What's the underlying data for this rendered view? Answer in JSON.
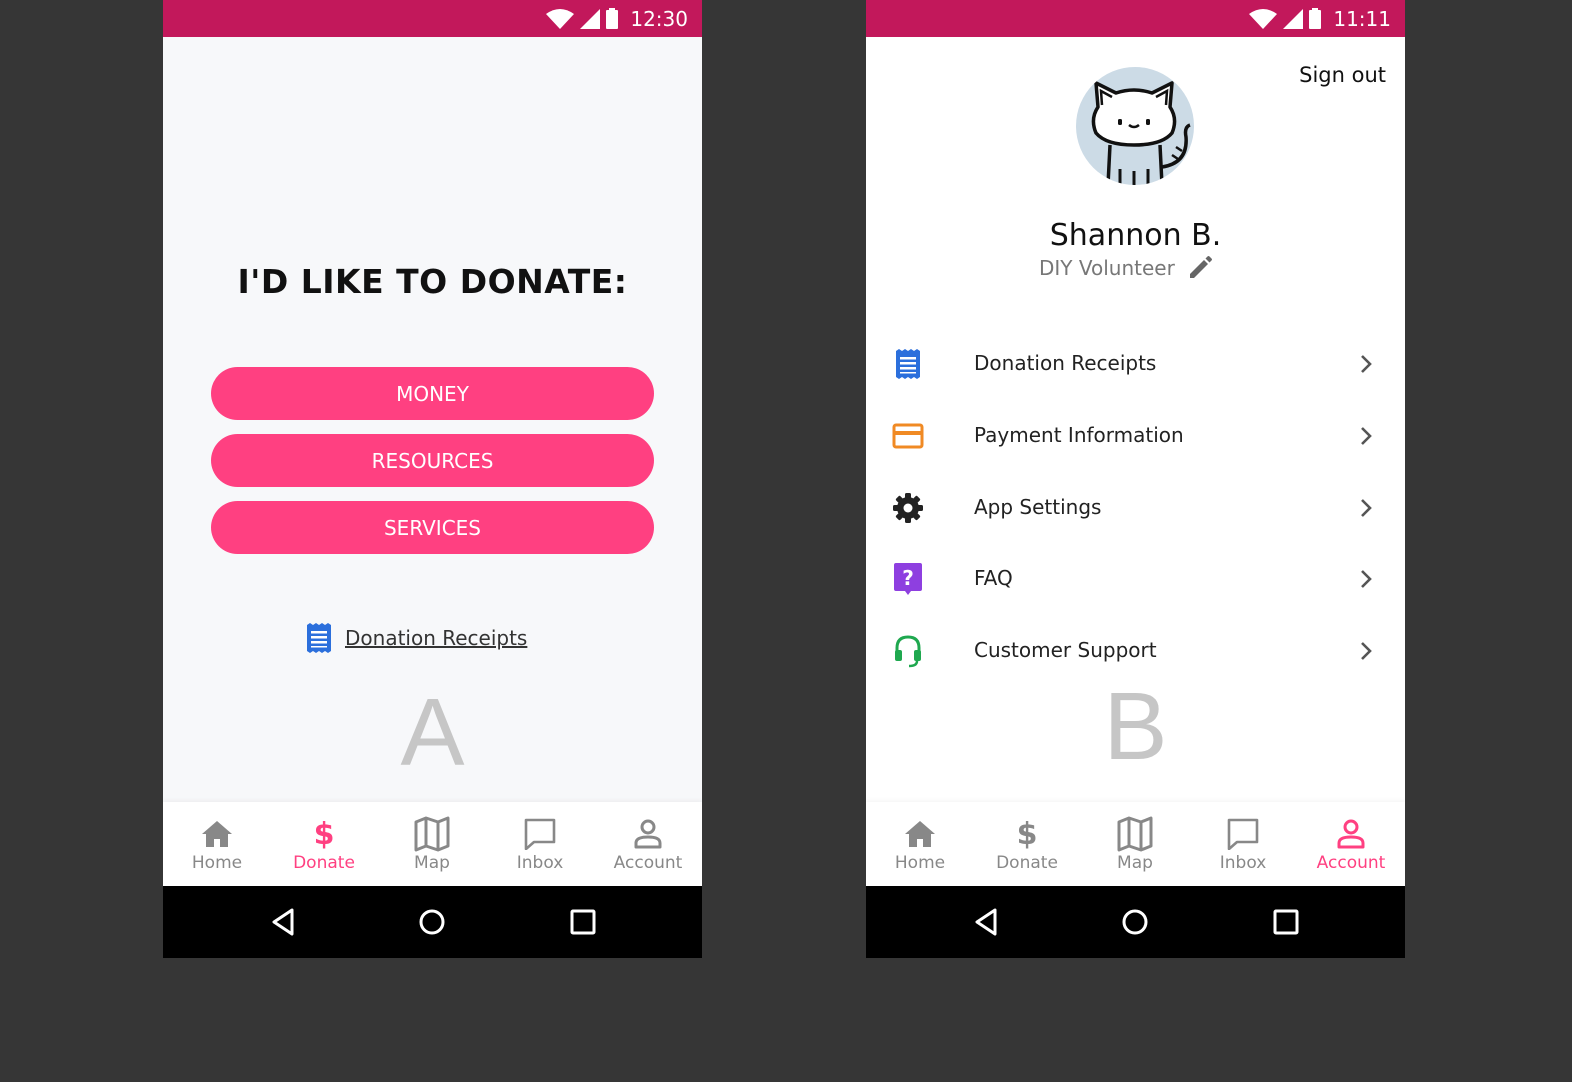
{
  "screen_a": {
    "status_time": "12:30",
    "heading": "I'D LIKE TO DONATE:",
    "options": [
      "MONEY",
      "RESOURCES",
      "SERVICES"
    ],
    "receipts_link": "Donation Receipts",
    "variant_label": "A",
    "tabs": [
      "Home",
      "Donate",
      "Map",
      "Inbox",
      "Account"
    ],
    "active_tab": "Donate"
  },
  "screen_b": {
    "status_time": "11:11",
    "sign_out": "Sign out",
    "user_name": "Shannon B.",
    "user_role": "DIY Volunteer",
    "menu": [
      {
        "label": "Donation Receipts",
        "icon": "receipt-icon",
        "color": "#2b6fdc"
      },
      {
        "label": "Payment Information",
        "icon": "credit-card-icon",
        "color": "#f08a24"
      },
      {
        "label": "App Settings",
        "icon": "gear-icon",
        "color": "#222222"
      },
      {
        "label": "FAQ",
        "icon": "help-icon",
        "color": "#8e3fe0"
      },
      {
        "label": "Customer Support",
        "icon": "headset-icon",
        "color": "#1fa84f"
      }
    ],
    "variant_label": "B",
    "tabs": [
      "Home",
      "Donate",
      "Map",
      "Inbox",
      "Account"
    ],
    "active_tab": "Account"
  },
  "colors": {
    "status_bar": "#c2185b",
    "accent": "#ff4081",
    "inactive_tab": "#888888",
    "background": "#363636"
  }
}
